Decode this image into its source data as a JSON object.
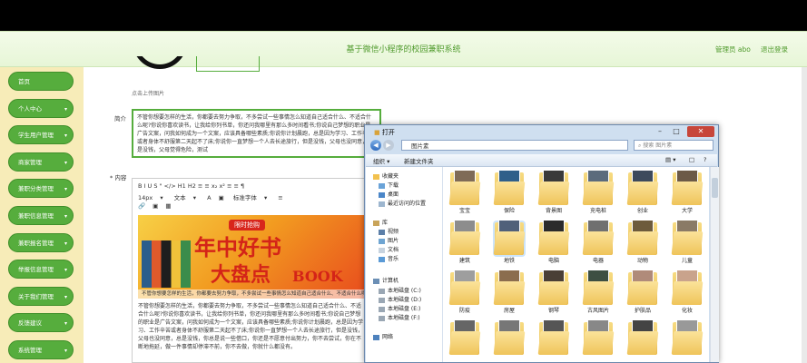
{
  "header": {
    "title": "基于微信小程序的校园兼职系统",
    "user": "管理员 abo",
    "logout": "退出登录"
  },
  "sidebar": {
    "items": [
      {
        "label": "首页",
        "chevron": false
      },
      {
        "label": "个人中心",
        "chevron": true
      },
      {
        "label": "学生用户管理",
        "chevron": true
      },
      {
        "label": "商家管理",
        "chevron": true
      },
      {
        "label": "兼职分类管理",
        "chevron": true
      },
      {
        "label": "兼职信息管理",
        "chevron": true
      },
      {
        "label": "兼职报名管理",
        "chevron": true
      },
      {
        "label": "举报信息管理",
        "chevron": true
      },
      {
        "label": "关于我们管理",
        "chevron": true
      },
      {
        "label": "反馈建议",
        "chevron": true
      },
      {
        "label": "系统管理",
        "chevron": true
      }
    ]
  },
  "form": {
    "upload_hint": "点击上传图片",
    "intro_label": "简介",
    "intro_text": "不管你想要怎样的生活，你都要去努力争取，不多尝试一些事情怎么知道自己适合什么、不适合什么呢?你说你喜欢读书，让我给你列书单，你还问我哪里有那么多时间看书;你说自己梦想的职业是广告文案，问我如何成为一个文案，应该具备哪些素质;你说你计划晨跑，总是因为学习、工作辛苦或者身体不舒服第二天起不了床;你说你一直梦想一个人去长途旅行，但是没钱，父母也没同意，总是没钱，父母觉得危险，测试",
    "content_label": "* 内容",
    "toolbar_row1": "B  I  U  S  \"  </>  H1  H2  ≡  ≡  x₂  x²  ≡  ≡  ¶",
    "toolbar_row2_size": "14px",
    "toolbar_row2_text": "文本",
    "toolbar_row2_font": "标准字体",
    "banner_tag": "限时抢购",
    "banner_line1": "年中好书",
    "banner_line2": "大盘点",
    "banner_book": "BOOK",
    "banner_strip": "不管你想要怎样的生活，你都要去努力争取，不多尝试一些事情怎么知道自己适合什么、不适合什么呢?",
    "body_text": "不管你想要怎样的生活，你都要去努力争取，不多尝试一些事情怎么知道自己适合什么、不适合什么呢?你说你喜欢读书，让我给你列书单，你还问我哪里有那么多时间看书;你说自己梦想的职业是广告文案，问我如何成为一个文案，应该具备哪些素质;你说你计划晨跑，总是因为学习、工作辛苦或者身体不舒服第二天起不了床;你说你一直梦想一个人去长途旅行，但是没钱，父母也没同意，总是没钱，你总是说一些借口，你还是不愿意付出努力，你不去尝试，你在不断地拖延，做一件事情却停滞不前，你不去做，你就什么都没有。"
  },
  "dialog": {
    "title": "打开",
    "path": "图片素",
    "search_placeholder": "搜索 图片素",
    "organize": "组织 ▾",
    "new_folder": "新建文件夹",
    "nav": {
      "favorites": "收藏夹",
      "downloads": "下载",
      "desktop": "桌面",
      "recent": "最近访问的位置",
      "libraries": "库",
      "videos": "视频",
      "pictures": "图片",
      "documents": "文档",
      "music": "音乐",
      "computer": "计算机",
      "disk_c": "本地磁盘 (C:)",
      "disk_d": "本地磁盘 (D:)",
      "disk_e": "本地磁盘 (E:)",
      "disk_f": "本地磁盘 (F:)",
      "network": "网络"
    },
    "folders": [
      "宝宝",
      "保险",
      "背景图",
      "充电桩",
      "创业",
      "大学",
      "建筑",
      "地铁",
      "电脑",
      "电器",
      "动物",
      "儿童",
      "防疫",
      "房屋",
      "钢琴",
      "古风图片",
      "护肤品",
      "化妆",
      "",
      "",
      "",
      "",
      "",
      ""
    ]
  }
}
